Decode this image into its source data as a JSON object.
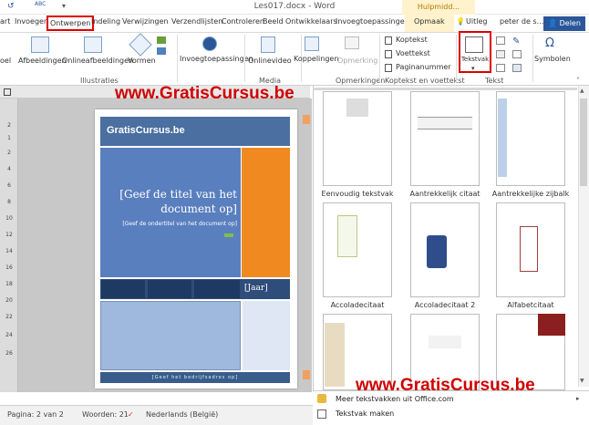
{
  "title_bar": {
    "title": "Les017.docx - Word",
    "context_tab_title": "Hulpmidd..."
  },
  "menu_tabs": [
    "art",
    "Invoegen",
    "Ontwerpen",
    "Indeling",
    "Verwijzingen",
    "Verzendlijsten",
    "Controleren",
    "Beeld",
    "Ontwikkelaars",
    "Invoegtoepassingen",
    "Opmaak"
  ],
  "tell_me": "Uitleg",
  "user": "peter de s...",
  "share": "Delen",
  "ribbon": {
    "left_partial": "oel",
    "afbeeldingen": "Afbeeldingen",
    "onlineafbeeldingen": "Onlineafbeeldingen",
    "vormen": "Vormen",
    "invoegtoepassingen": "Invoegtoepassingen",
    "onlinevideo": "Onlinevideo",
    "koppelingen": "Koppelingen",
    "opmerking": "Opmerking",
    "koptekst": "Koptekst",
    "voettekst": "Voettekst",
    "paginanummer": "Paginanummer",
    "tekstvak": "Tekstvak",
    "symbolen": "Symbolen",
    "groups": {
      "illustraties": "Illustraties",
      "media": "Media",
      "opmerkingen": "Opmerkingen",
      "koptekst_voettekst": "Koptekst en voettekst",
      "tekst": "Tekst"
    }
  },
  "watermark": "www.GratisCursus.be",
  "document": {
    "brand": "GratisCursus.be",
    "title_placeholder": "[Geef de titel van het document op]",
    "subtitle_placeholder": "[Geef de ondertitel van het document op]",
    "year_placeholder": "[Jaar]",
    "footer_placeholder": "[Geef het bedrijfsadres op]"
  },
  "ruler_marks": [
    "2",
    "1",
    "2",
    "4",
    "6",
    "8",
    "10",
    "12",
    "14",
    "16",
    "18",
    "20",
    "22",
    "24",
    "26"
  ],
  "gallery": {
    "items": [
      "Eenvoudig tekstvak",
      "Aantrekkelijk citaat",
      "Aantrekkelijke zijbalk",
      "Accoladecitaat",
      "Accoladecitaat 2",
      "Alfabetcitaat"
    ],
    "more": "Meer tekstvakken uit Office.com",
    "create": "Tekstvak maken"
  },
  "status": {
    "page": "Pagina: 2 van 2",
    "words": "Woorden: 21",
    "language": "Nederlands (België)"
  },
  "colors": {
    "accent": "#2b579a",
    "highlight": "#dd0000",
    "cover_blue": "#5a7fbf",
    "cover_orange": "#f08a20"
  }
}
